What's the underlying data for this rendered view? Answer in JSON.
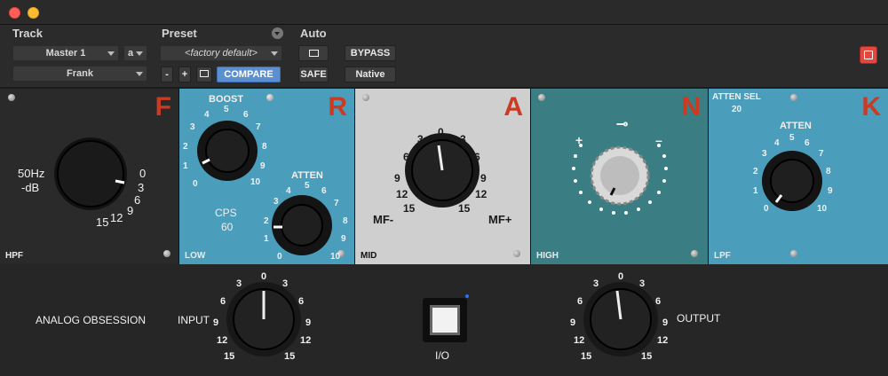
{
  "header": {
    "track_label": "Track",
    "preset_label": "Preset",
    "auto_label": "Auto",
    "track_name": "Master 1",
    "track_channel": "a",
    "user_name": "Frank",
    "preset_name": "<factory default>",
    "minus_label": "-",
    "plus_label": "+",
    "compare_label": "COMPARE",
    "safe_label": "SAFE",
    "bypass_label": "BYPASS",
    "native_label": "Native"
  },
  "panels": {
    "f": {
      "letter": "F",
      "freq": "50Hz",
      "db": "-dB",
      "corner": "HPF",
      "scale": [
        "0",
        "3",
        "6",
        "9",
        "12",
        "15"
      ]
    },
    "r": {
      "letter": "R",
      "boost": "BOOST",
      "atten": "ATTEN",
      "cps": "CPS",
      "cps_value": "60",
      "corner": "LOW",
      "scale": [
        "0",
        "1",
        "2",
        "3",
        "4",
        "5",
        "6",
        "7",
        "8",
        "9",
        "10"
      ]
    },
    "a": {
      "letter": "A",
      "mf_minus": "MF-",
      "mf_plus": "MF+",
      "corner": "MID",
      "scale": [
        "15",
        "12",
        "9",
        "6",
        "3",
        "0",
        "3",
        "6",
        "9",
        "12",
        "15"
      ]
    },
    "n": {
      "letter": "N",
      "plus": "+",
      "minus": "–",
      "corner": "HIGH"
    },
    "k": {
      "letter": "K",
      "atten_sel": "ATTEN SEL",
      "atten_sel_value": "20",
      "atten": "ATTEN",
      "corner": "LPF",
      "scale": [
        "0",
        "1",
        "2",
        "3",
        "4",
        "5",
        "6",
        "7",
        "8",
        "9",
        "10"
      ]
    }
  },
  "bottom": {
    "brand": "ANALOG OBSESSION",
    "input_label": "INPUT",
    "output_label": "OUTPUT",
    "io_label": "I/O",
    "scale": [
      "15",
      "12",
      "9",
      "6",
      "3",
      "0",
      "3",
      "6",
      "9",
      "12",
      "15"
    ]
  },
  "colors": {
    "panel_blue": "#4a9dbb",
    "panel_teal": "#3a7e84",
    "panel_dark": "#262626",
    "panel_light": "#cfcfcf",
    "letter_red": "#cc3a22",
    "compare_blue": "#5b8fd0"
  }
}
